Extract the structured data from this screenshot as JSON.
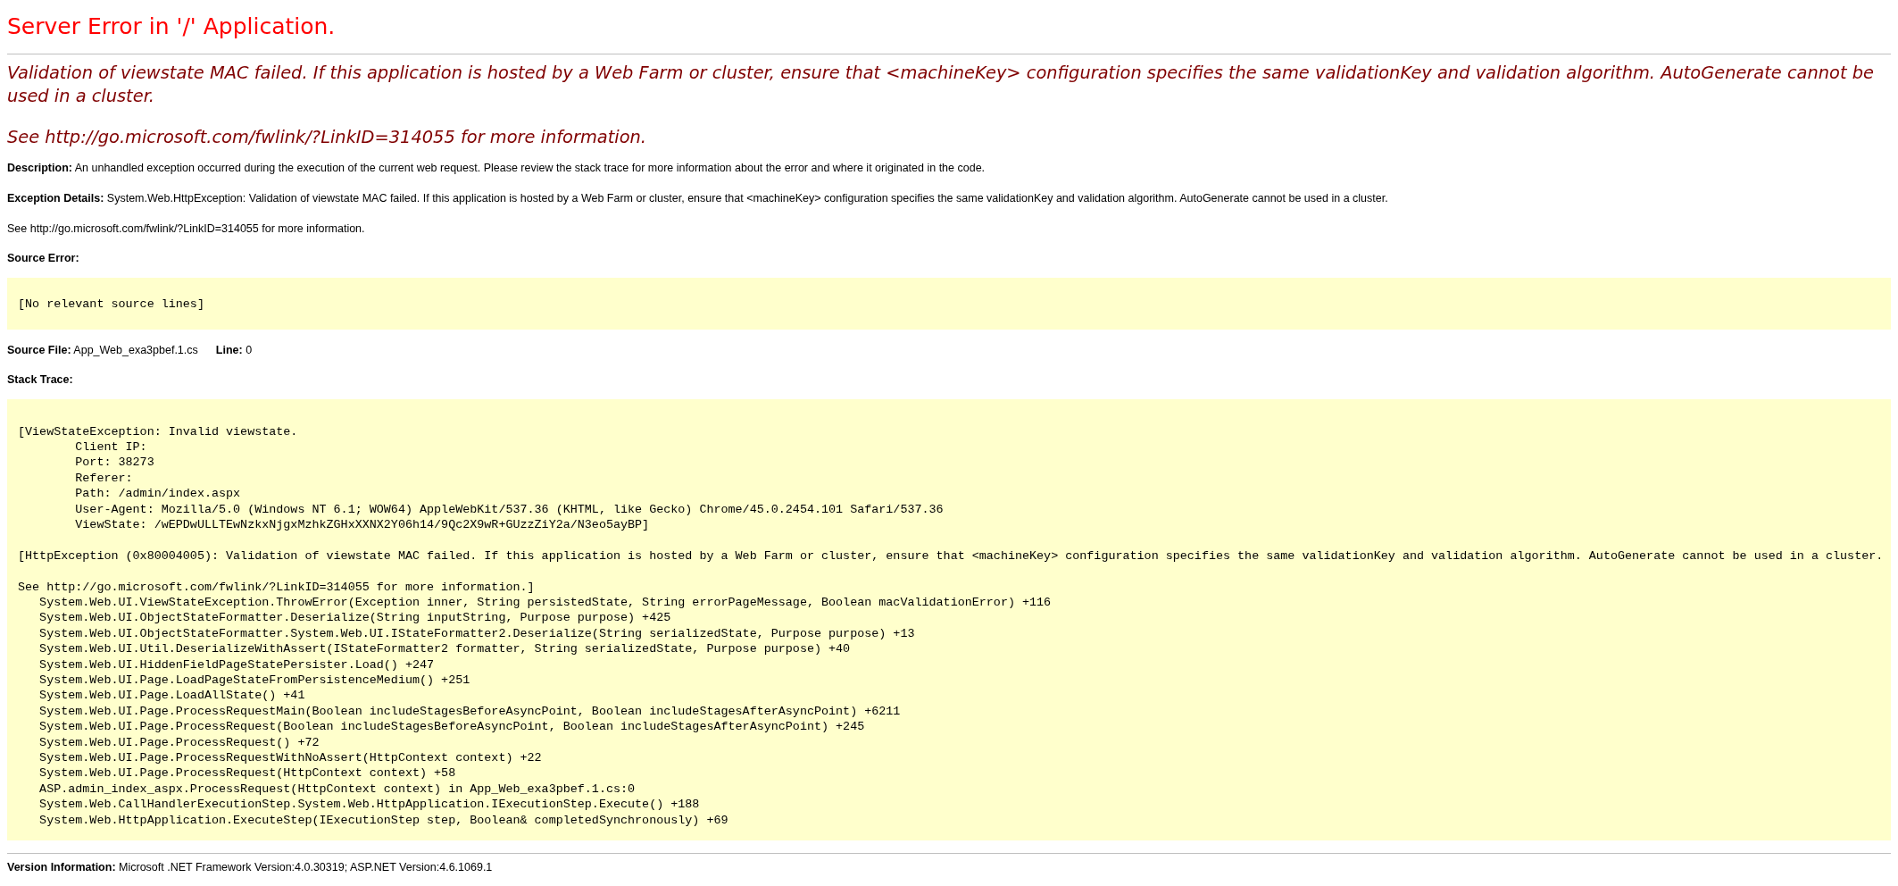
{
  "title": "Server Error in '/' Application.",
  "message": "Validation of viewstate MAC failed. If this application is hosted by a Web Farm or cluster, ensure that <machineKey> configuration specifies the same validationKey and validation algorithm. AutoGenerate cannot be used in a cluster.",
  "more_info": "See http://go.microsoft.com/fwlink/?LinkID=314055 for more information.",
  "description": {
    "label": "Description:",
    "text": "An unhandled exception occurred during the execution of the current web request. Please review the stack trace for more information about the error and where it originated in the code."
  },
  "exception_details": {
    "label": "Exception Details:",
    "text": "System.Web.HttpException: Validation of viewstate MAC failed. If this application is hosted by a Web Farm or cluster, ensure that <machineKey> configuration specifies the same validationKey and validation algorithm. AutoGenerate cannot be used in a cluster."
  },
  "see_also": "See http://go.microsoft.com/fwlink/?LinkID=314055 for more information.",
  "source_error": {
    "label": "Source Error:",
    "lines": [
      "[No relevant source lines]"
    ]
  },
  "source_file": {
    "label": "Source File:",
    "value": "App_Web_exa3pbef.1.cs"
  },
  "line": {
    "label": "Line:",
    "value": "0"
  },
  "stack_trace": {
    "label": "Stack Trace:",
    "blocks": [
      [
        "[ViewStateException: Invalid viewstate. ",
        "        Client IP: ",
        "        Port: 38273",
        "        Referer: ",
        "        Path: /admin/index.aspx",
        "        User-Agent: Mozilla/5.0 (Windows NT 6.1; WOW64) AppleWebKit/537.36 (KHTML, like Gecko) Chrome/45.0.2454.101 Safari/537.36",
        "        ViewState: /wEPDwULLTEwNzkxNjgxMzhkZGHxXXNX2Y06h14/9Qc2X9wR+GUzzZiY2a/N3eo5ayBP]"
      ],
      [
        "[HttpException (0x80004005): Validation of viewstate MAC failed. If this application is hosted by a Web Farm or cluster, ensure that <machineKey> configuration specifies the same validationKey and validation algorithm. AutoGenerate cannot be used in a cluster."
      ],
      [
        "See http://go.microsoft.com/fwlink/?LinkID=314055 for more information.]",
        "   System.Web.UI.ViewStateException.ThrowError(Exception inner, String persistedState, String errorPageMessage, Boolean macValidationError) +116",
        "   System.Web.UI.ObjectStateFormatter.Deserialize(String inputString, Purpose purpose) +425",
        "   System.Web.UI.ObjectStateFormatter.System.Web.UI.IStateFormatter2.Deserialize(String serializedState, Purpose purpose) +13",
        "   System.Web.UI.Util.DeserializeWithAssert(IStateFormatter2 formatter, String serializedState, Purpose purpose) +40",
        "   System.Web.UI.HiddenFieldPageStatePersister.Load() +247",
        "   System.Web.UI.Page.LoadPageStateFromPersistenceMedium() +251",
        "   System.Web.UI.Page.LoadAllState() +41",
        "   System.Web.UI.Page.ProcessRequestMain(Boolean includeStagesBeforeAsyncPoint, Boolean includeStagesAfterAsyncPoint) +6211",
        "   System.Web.UI.Page.ProcessRequest(Boolean includeStagesBeforeAsyncPoint, Boolean includeStagesAfterAsyncPoint) +245",
        "   System.Web.UI.Page.ProcessRequest() +72",
        "   System.Web.UI.Page.ProcessRequestWithNoAssert(HttpContext context) +22",
        "   System.Web.UI.Page.ProcessRequest(HttpContext context) +58",
        "   ASP.admin_index_aspx.ProcessRequest(HttpContext context) in App_Web_exa3pbef.1.cs:0",
        "   System.Web.CallHandlerExecutionStep.System.Web.HttpApplication.IExecutionStep.Execute() +188",
        "   System.Web.HttpApplication.ExecuteStep(IExecutionStep step, Boolean& completedSynchronously) +69"
      ]
    ]
  },
  "version": {
    "label": "Version Information:",
    "text": "Microsoft .NET Framework Version:4.0.30319; ASP.NET Version:4.6.1069.1"
  }
}
